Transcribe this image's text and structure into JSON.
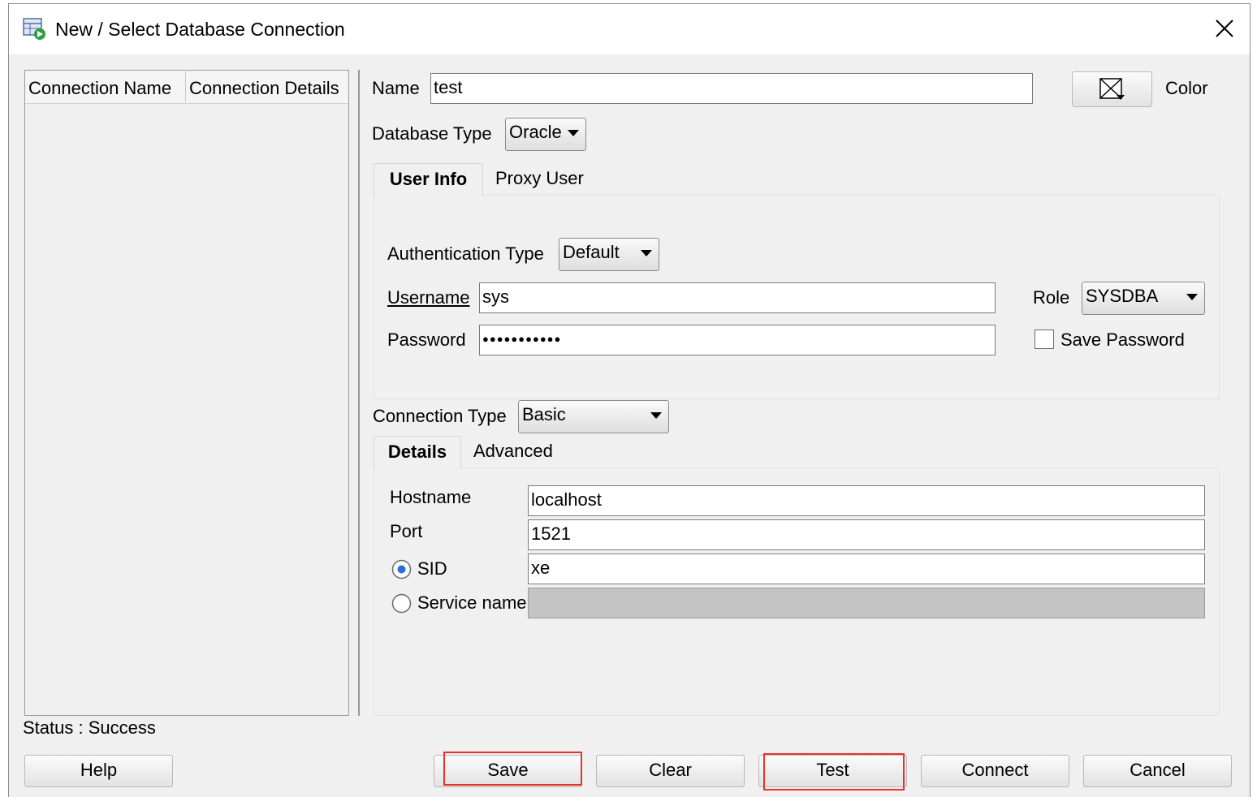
{
  "window": {
    "title": "New / Select Database Connection"
  },
  "list": {
    "columns": [
      "Connection Name",
      "Connection Details"
    ]
  },
  "form": {
    "name_label": "Name",
    "name_value": "test",
    "color_label": "Color",
    "dbtype_label": "Database Type",
    "dbtype_value": "Oracle",
    "tabs": [
      "User Info",
      "Proxy User"
    ],
    "auth_label": "Authentication Type",
    "auth_value": "Default",
    "username_label": "Username",
    "username_value": "sys",
    "password_label": "Password",
    "password_mask": "●●●●●●●●●●●",
    "role_label": "Role",
    "role_value": "SYSDBA",
    "save_password_label": "Save Password",
    "conntype_label": "Connection Type",
    "conntype_value": "Basic",
    "detail_tabs": [
      "Details",
      "Advanced"
    ],
    "hostname_label": "Hostname",
    "hostname_value": "localhost",
    "port_label": "Port",
    "port_value": "1521",
    "sid_label": "SID",
    "sid_value": "xe",
    "service_label": "Service name",
    "service_value": ""
  },
  "status": "Status : Success",
  "buttons": {
    "help": "Help",
    "save": "Save",
    "clear": "Clear",
    "test": "Test",
    "connect": "Connect",
    "cancel": "Cancel"
  },
  "colors": {
    "dialog_bg": "#f0f0f0",
    "highlight": "#e8322a",
    "radio_dot": "#2a6fd6"
  }
}
